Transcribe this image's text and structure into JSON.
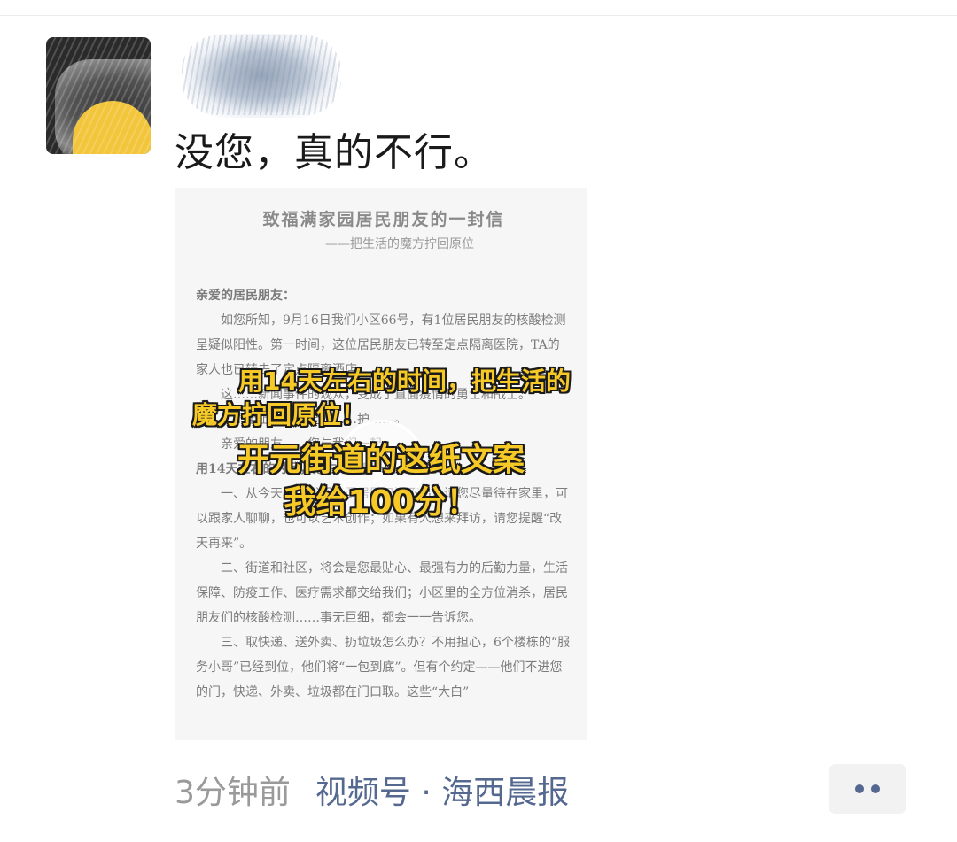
{
  "post": {
    "text": "没您，真的不行。"
  },
  "video": {
    "doc_title": "致福满家园居民朋友的一封信",
    "doc_subtitle": "——把生活的魔方拧回原位",
    "doc_salutation": "亲爱的居民朋友：",
    "doc_paragraph_1": "如您所知，9月16日我们小区66号，有1位居民朋友的核酸检测呈疑似阳性。第一时间，这位居民朋友已转至定点隔离医院，TA的家人也已转去了定点隔离酒店。",
    "doc_paragraph_2": "这……新闻事件的观众，变成了直面疫情的勇士和战士。",
    "doc_paragraph_3": "……至上，……全力……护……。",
    "doc_paragraph_4": "亲爱的朋友……您与我们一起，",
    "doc_bold_line": "用14天左右的时间，把生活的魔方拧回原位：",
    "doc_paragraph_5": "一、从今天起，我们小区居民只进不出，请您尽量待在家里，可以跟家人聊聊，也可以艺术创作；如果有人想来拜访，请您提醒“改天再来”。",
    "doc_paragraph_6": "二、街道和社区，将会是您最贴心、最强有力的后勤力量，生活保障、防疫工作、医疗需求都交给我们；小区里的全方位消杀，居民朋友们的核酸检测……事无巨细，都会一一告诉您。",
    "doc_paragraph_7": "三、取快递、送外卖、扔垃圾怎么办？不用担心，6个楼栋的“服务小哥”已经到位，他们将“一包到底”。但有个约定——他们不进您的门，快递、外卖、垃圾都在门口取。这些“大白”",
    "caption_line_1a": "用14天左右的时间，把生活的",
    "caption_line_1b": "魔方拧回原位！",
    "caption_line_2a": "开元街道的这纸文案",
    "caption_line_2b": "我给100分！"
  },
  "meta": {
    "time": "3分钟前",
    "channel": "视频号 · 海西晨报"
  },
  "colors": {
    "caption_yellow": "#f7c926",
    "link_blue": "#55688f",
    "time_gray": "#9a9a9a"
  },
  "icons": {
    "play": "play-icon",
    "more": "more-dots-icon"
  }
}
